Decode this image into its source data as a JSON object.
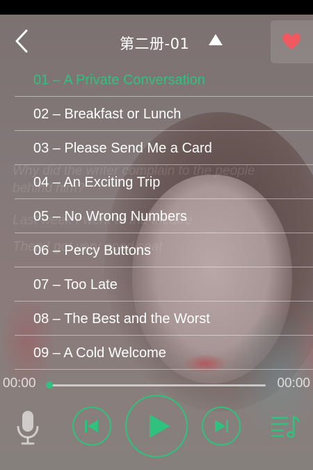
{
  "header": {
    "title": "第二册-01"
  },
  "ghost_text": [
    "Why did the writer complain to the people",
    "behind him?",
    "Last week I went to the theatre",
    "Then I got very good seat"
  ],
  "lessons": [
    {
      "label": "01 – A Private Conversation",
      "active": true
    },
    {
      "label": "02 – Breakfast or Lunch",
      "active": false
    },
    {
      "label": "03 – Please Send Me a Card",
      "active": false
    },
    {
      "label": "04 – An Exciting Trip",
      "active": false
    },
    {
      "label": "05 – No Wrong Numbers",
      "active": false
    },
    {
      "label": "06 – Percy Buttons",
      "active": false
    },
    {
      "label": "07 – Too Late",
      "active": false
    },
    {
      "label": "08 – The Best and the Worst",
      "active": false
    },
    {
      "label": "09 – A Cold Welcome",
      "active": false
    }
  ],
  "player": {
    "current_time": "00:00",
    "total_time": "00:00",
    "progress": 0
  },
  "icons": {
    "back": "chevron-left-icon",
    "collapse": "triangle-up-icon",
    "favorite": "heart-icon",
    "mic": "microphone-icon",
    "prev": "skip-previous-icon",
    "play": "play-icon",
    "next": "skip-next-icon",
    "playlist": "playlist-music-icon"
  },
  "colors": {
    "accent": "#2ec27e",
    "heart": "#f0595f",
    "status_bar": "#000000"
  }
}
